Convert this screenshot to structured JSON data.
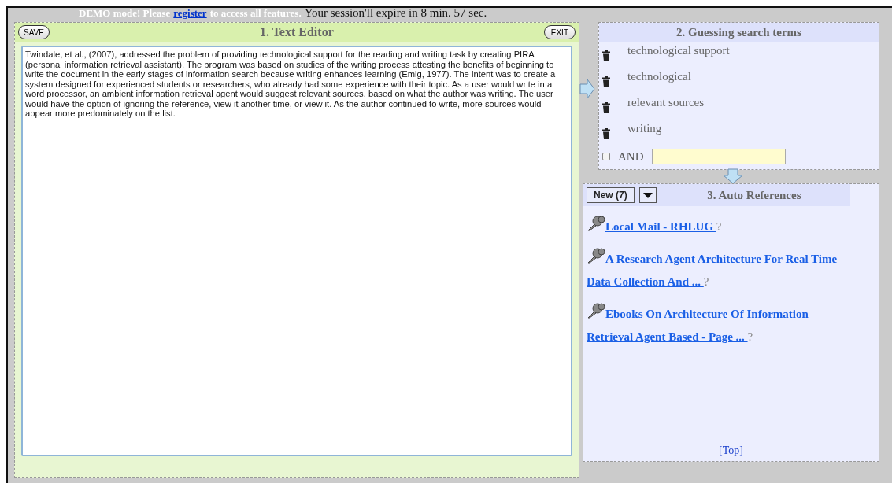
{
  "banner": {
    "before": "DEMO mode! Please",
    "link": "register",
    "after": "to access all features.",
    "session": "Your session'll expire in 8 min. 57 sec."
  },
  "editor": {
    "title": "1. Text Editor",
    "save": "SAVE",
    "exit": "EXIT",
    "value": "Twindale, et al., (2007), addressed the problem of providing technological support for the reading and writing task by creating PIRA (personal information retrieval assistant). The program was based on studies of the writing process attesting the benefits of beginning to write the document in the early stages of information search because writing enhances learning (Emig, 1977). The intent was to create a system designed for experienced students or researchers, who already had some experience with their topic. As a user would write in a word processor, an ambient information retrieval agent would suggest relevant sources, based on what the author was writing. The user would have the option of ignoring the reference, view it another time, or view it. As the author continued to write, more sources would appear more predominately on the list."
  },
  "search_terms": {
    "title": "2. Guessing search terms",
    "terms": [
      "technological support",
      "technological",
      "relevant sources",
      "writing"
    ],
    "and_checkbox": {
      "label": "AND",
      "checked": false
    }
  },
  "references": {
    "title": "3. Auto References",
    "new_button": "New (7)",
    "items": [
      {
        "title_lines": [
          "Local Mail - RHLUG "
        ],
        "help": "?"
      },
      {
        "title_lines": [
          "A Research Agent Architecture For Real Time",
          "Data Collection And ... "
        ],
        "help": "?"
      },
      {
        "title_lines": [
          "Ebooks On Architecture Of Information",
          "Retrieval Agent Based - Page ... "
        ],
        "help": "?"
      }
    ],
    "top_link": "[Top]"
  }
}
